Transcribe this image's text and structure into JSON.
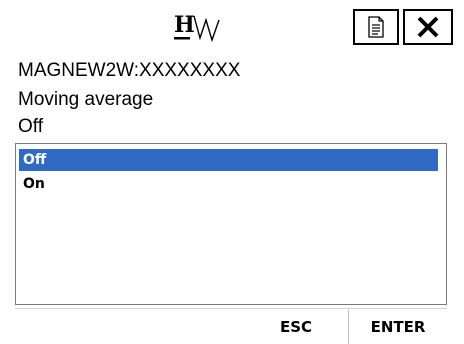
{
  "header": {
    "logo_icon": "hw-logo-icon",
    "document_icon": "document-icon",
    "close_icon": "close-icon"
  },
  "device_id": "MAGNEW2W:XXXXXXXX",
  "parameter": {
    "name": "Moving average",
    "current_value": "Off"
  },
  "options": [
    {
      "label": "Off",
      "selected": true
    },
    {
      "label": "On",
      "selected": false
    }
  ],
  "colors": {
    "selection": "#316ac5"
  },
  "soft_keys": {
    "esc": "ESC",
    "enter": "ENTER"
  }
}
